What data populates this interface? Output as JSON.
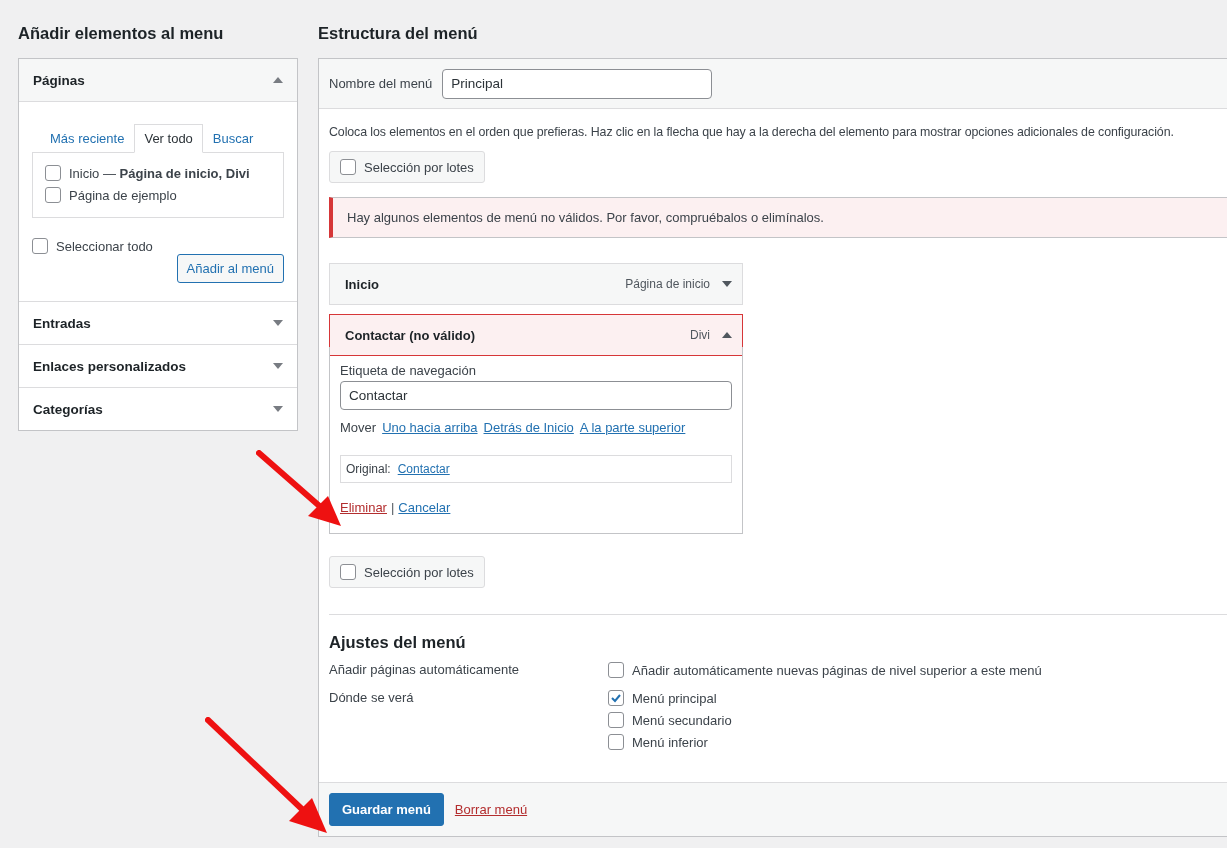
{
  "left": {
    "title": "Añadir elementos al menu",
    "sections": [
      {
        "title": "Páginas",
        "expanded": true
      },
      {
        "title": "Entradas",
        "expanded": false
      },
      {
        "title": "Enlaces personalizados",
        "expanded": false
      },
      {
        "title": "Categorías",
        "expanded": false
      }
    ],
    "tabs": [
      {
        "label": "Más reciente",
        "selected": false
      },
      {
        "label": "Ver todo",
        "selected": true
      },
      {
        "label": "Buscar",
        "selected": false
      }
    ],
    "pages": [
      {
        "label": "Inicio — **Página de inicio, Divi**",
        "checked": false
      },
      {
        "label": "Página de ejemplo",
        "checked": false
      }
    ],
    "select_all": {
      "label": "Seleccionar todo",
      "checked": false
    },
    "add_button": "Añadir al menú"
  },
  "right": {
    "title": "Estructura del menú",
    "name_label": "Nombre del menú",
    "name_value": "Principal",
    "description": "Coloca los elementos en el orden que prefieras. Haz clic en la flecha que hay a la derecha del elemento para mostrar opciones adicionales de configuración.",
    "bulk_top": {
      "label": "Selección por lotes",
      "checked": false
    },
    "notice": "Hay algunos elementos de menú no válidos. Por favor, compruébalos o elimínalos.",
    "items": [
      {
        "title": "Inicio",
        "type": "Página de inicio",
        "expanded": false,
        "invalid": false
      },
      {
        "title": "Contactar (no válido)",
        "type": "Divi",
        "expanded": true,
        "invalid": true
      }
    ],
    "item_settings": {
      "nav_label": "Etiqueta de navegación",
      "nav_value": "Contactar",
      "move_label": "Mover",
      "move_links": [
        "Uno hacia arriba",
        "Detrás de Inicio",
        "A la parte superior"
      ],
      "original_label": "Original:",
      "original_link": "Contactar",
      "remove": "Eliminar",
      "separator": "|",
      "cancel": "Cancelar"
    },
    "bulk_bottom": {
      "label": "Selección por lotes",
      "checked": false
    },
    "settings": {
      "title": "Ajustes del menú",
      "rows": [
        {
          "label": "Añadir páginas automáticamente",
          "options": [
            {
              "label": "Añadir automáticamente nuevas páginas de nivel superior a este menú",
              "checked": false
            }
          ]
        },
        {
          "label": "Dónde se verá",
          "options": [
            {
              "label": "Menú principal",
              "checked": true
            },
            {
              "label": "Menú secundario",
              "checked": false
            },
            {
              "label": "Menú inferior",
              "checked": false
            }
          ]
        }
      ]
    },
    "save_button": "Guardar menú",
    "delete_link": "Borrar menú"
  }
}
